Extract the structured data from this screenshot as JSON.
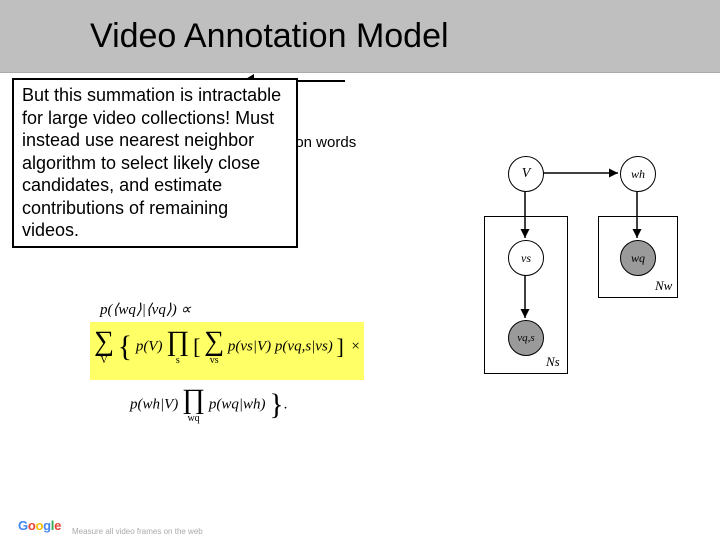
{
  "title": "Video Annotation Model",
  "callout_text": "But this summation is intractable for large video collections! Must instead use nearest neighbor algorithm to select likely close candidates, and estimate contributions of remaining videos.",
  "partial_text": "ion words",
  "math": {
    "top": "p(⟨wq⟩|⟨vq⟩) ∝",
    "hl_sum_sub": "V",
    "hl_pV": "p(V)",
    "hl_prod_sub": "s",
    "hl_inner_sum_sub": "vs",
    "hl_inner1": "p(vs|V)",
    "hl_inner2": "p(vq,s|vs)",
    "times": "×",
    "line2_a": "p(wh|V)",
    "line2_prod_sub": "wq",
    "line2_b": "p(wq|wh)"
  },
  "gm": {
    "V": "V",
    "wh": "wh",
    "vs": "vs",
    "wq": "wq",
    "vqs": "vq,s",
    "Ns": "Ns",
    "Nw": "Nw"
  },
  "logo_text": "Google",
  "mix_text": "Measure all\nvideo frames\non the web"
}
